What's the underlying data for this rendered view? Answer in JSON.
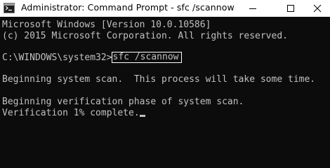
{
  "window": {
    "title": "Administrator: Command Prompt - sfc  /scannow"
  },
  "icons": {
    "app": "cmd-icon",
    "minimize": "minimize-icon",
    "maximize": "maximize-icon",
    "close": "close-icon"
  },
  "colors": {
    "console_bg": "#0c0c0c",
    "console_text": "#c0c0c0",
    "highlight_border": "#ffffff"
  },
  "console": {
    "version_line": "Microsoft Windows [Version 10.0.10586]",
    "copyright_line": "(c) 2015 Microsoft Corporation. All rights reserved.",
    "prompt": "C:\\WINDOWS\\system32>",
    "command": "sfc /scannow",
    "scan_begin": "Beginning system scan.  This process will take some time.",
    "verification_begin": "Beginning verification phase of system scan.",
    "verification_progress": "Verification 1% complete."
  }
}
